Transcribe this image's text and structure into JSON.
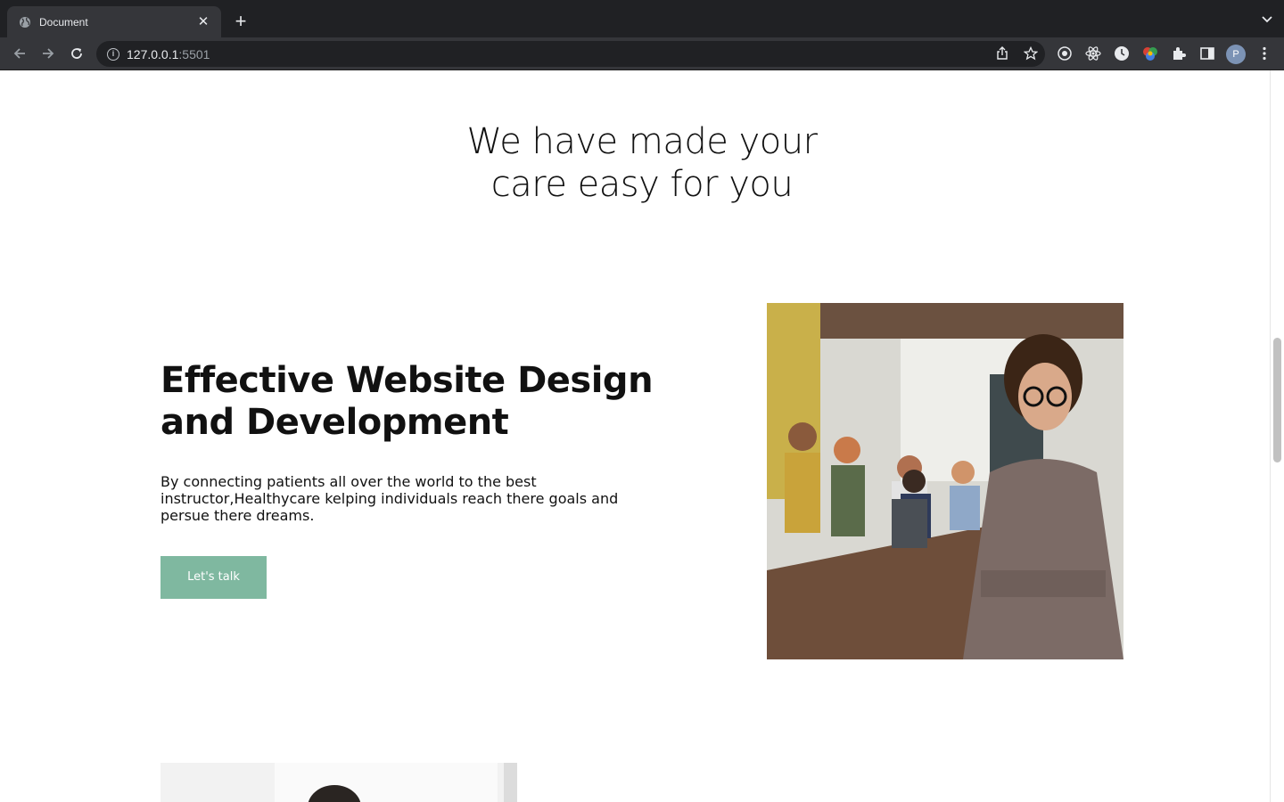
{
  "browser": {
    "tab_title": "Document",
    "new_tab_label": "+",
    "url_host": "127.0.0.1",
    "url_port": ":5501",
    "profile_initial": "P"
  },
  "page": {
    "hero_title_line1": "We have made your",
    "hero_title_line2": "care easy for you",
    "feature_title": "Effective Website Design and Development",
    "feature_text": "By connecting patients all over the world to the best instructor,Healthycare kelping individuals reach there goals and persue there dreams.",
    "cta_label": "Let's talk"
  },
  "colors": {
    "cta_background": "#7fb8a0",
    "chrome_dark": "#202124",
    "chrome_mid": "#35363a"
  }
}
